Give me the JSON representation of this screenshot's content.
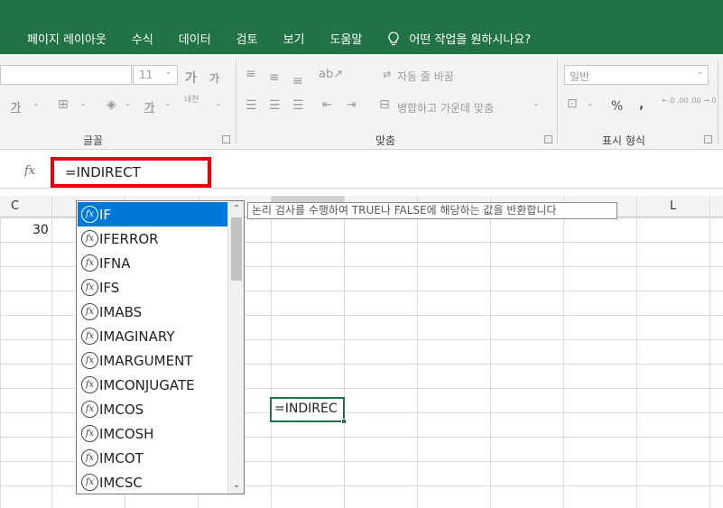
{
  "menu": {
    "items": [
      "페이지 레이아웃",
      "수식",
      "데이터",
      "검토",
      "보기",
      "도움말"
    ],
    "tell_me": "어떤 작업을 원하시나요?"
  },
  "ribbon": {
    "font_size": "11",
    "grow_font": "가",
    "shrink_font": "가",
    "bold_label": "가",
    "underline_label": "가",
    "phonetic_label": "내천",
    "wrap_text": "자동 줄 바꿈",
    "merge_center": "병합하고 가운데 맞춤",
    "number_format": "일반",
    "percent": "%",
    "comma": ",",
    "inc_decimal": "←.0 .00",
    "dec_decimal": ".00 →.0",
    "groups": {
      "font": "글꼴",
      "alignment": "맞춤",
      "number": "표시 형식"
    }
  },
  "formula_bar": {
    "fx": "fx",
    "value": "=INDIRECT"
  },
  "columns": {
    "c": "C",
    "l": "L"
  },
  "cells": {
    "c_value": "30",
    "active_value": "=INDIREC"
  },
  "autocomplete": {
    "items": [
      "IF",
      "IFERROR",
      "IFNA",
      "IFS",
      "IMABS",
      "IMAGINARY",
      "IMARGUMENT",
      "IMCONJUGATE",
      "IMCOS",
      "IMCOSH",
      "IMCOT",
      "IMCSC"
    ],
    "selected_index": 0
  },
  "tooltip": "논리 검사를 수행하여 TRUE나 FALSE에 해당하는 값을 반환합니다"
}
